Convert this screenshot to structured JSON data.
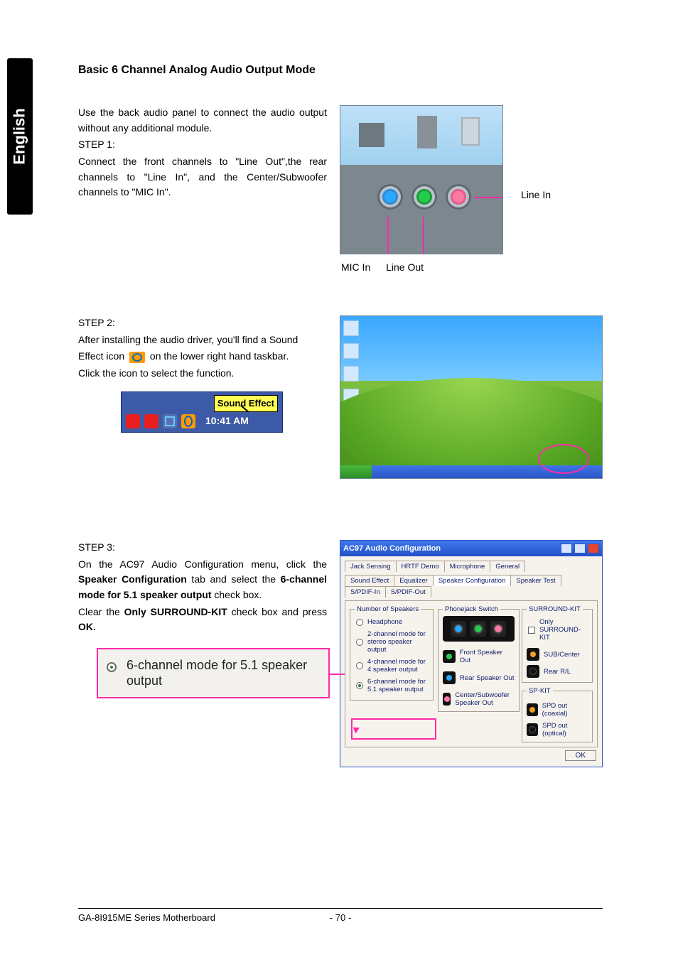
{
  "side_tab": "English",
  "heading": "Basic 6 Channel Analog Audio Output Mode",
  "intro": {
    "p1": "Use the back audio panel to connect the audio output without any additional module.",
    "step1_label": "STEP 1:",
    "step1_body": "Connect the front channels to \"Line Out\",the rear channels to \"Line In\", and the Center/Subwoofer channels to \"MIC In\"."
  },
  "audio_panel": {
    "label_line_in": "Line In",
    "caption_mic": "MIC In",
    "caption_lineout": "Line Out"
  },
  "step2": {
    "label": "STEP 2:",
    "line_a": "After installing the audio driver, you'll find a Sound",
    "line_b_pre": "Effect  icon",
    "line_b_post": "on the lower right hand taskbar.",
    "line_c": "Click the icon to select the function.",
    "tray_tooltip": "Sound Effect",
    "tray_clock": "10:41 AM"
  },
  "step3": {
    "label": "STEP 3:",
    "line1": "On the AC97 Audio Configuration menu, click the ",
    "bold1": "Speaker Configuration",
    "line2": " tab and select the ",
    "bold2": "6-channel mode for 5.1 speaker output",
    "line3": " check box.",
    "line4_pre": "Clear the ",
    "bold3": "Only SURROUND-KIT",
    "line4_post": " check box and press ",
    "bold_ok": "OK."
  },
  "radio_callout": "6-channel mode for 5.1 speaker output",
  "ac97": {
    "title": "AC97 Audio Configuration",
    "tabs_row1": [
      "Jack Sensing",
      "HRTF Demo",
      "Microphone",
      "General"
    ],
    "tabs_row2": [
      "Sound Effect",
      "Equalizer",
      "Speaker Configuration",
      "Speaker Test",
      "S/PDIF-In",
      "S/PDIF-Out"
    ],
    "grp_speakers": "Number of Speakers",
    "opt_headphone": "Headphone",
    "opt_2ch": "2-channel mode for stereo speaker output",
    "opt_4ch": "4-channel mode for 4 speaker output",
    "opt_6ch": "6-channel mode for 5.1 speaker output",
    "grp_pj": "Phonejack Switch",
    "lbl_front": "Front Speaker Out",
    "lbl_rear": "Rear Speaker Out",
    "lbl_center": "Center/Subwoofer Speaker Out",
    "grp_sk": "SURROUND-KIT",
    "chk_only": "Only SURROUND-KIT",
    "lbl_sub": "SUB/Center",
    "lbl_rearrl": "Rear R/L",
    "grp_spkit": "SP-KIT",
    "lbl_spd_coax": "SPD out (coaxial)",
    "lbl_spd_opt": "SPD out (optical)",
    "ok": "OK"
  },
  "footer": {
    "left": "GA-8I915ME Series Motherboard",
    "center": "- 70 -"
  }
}
